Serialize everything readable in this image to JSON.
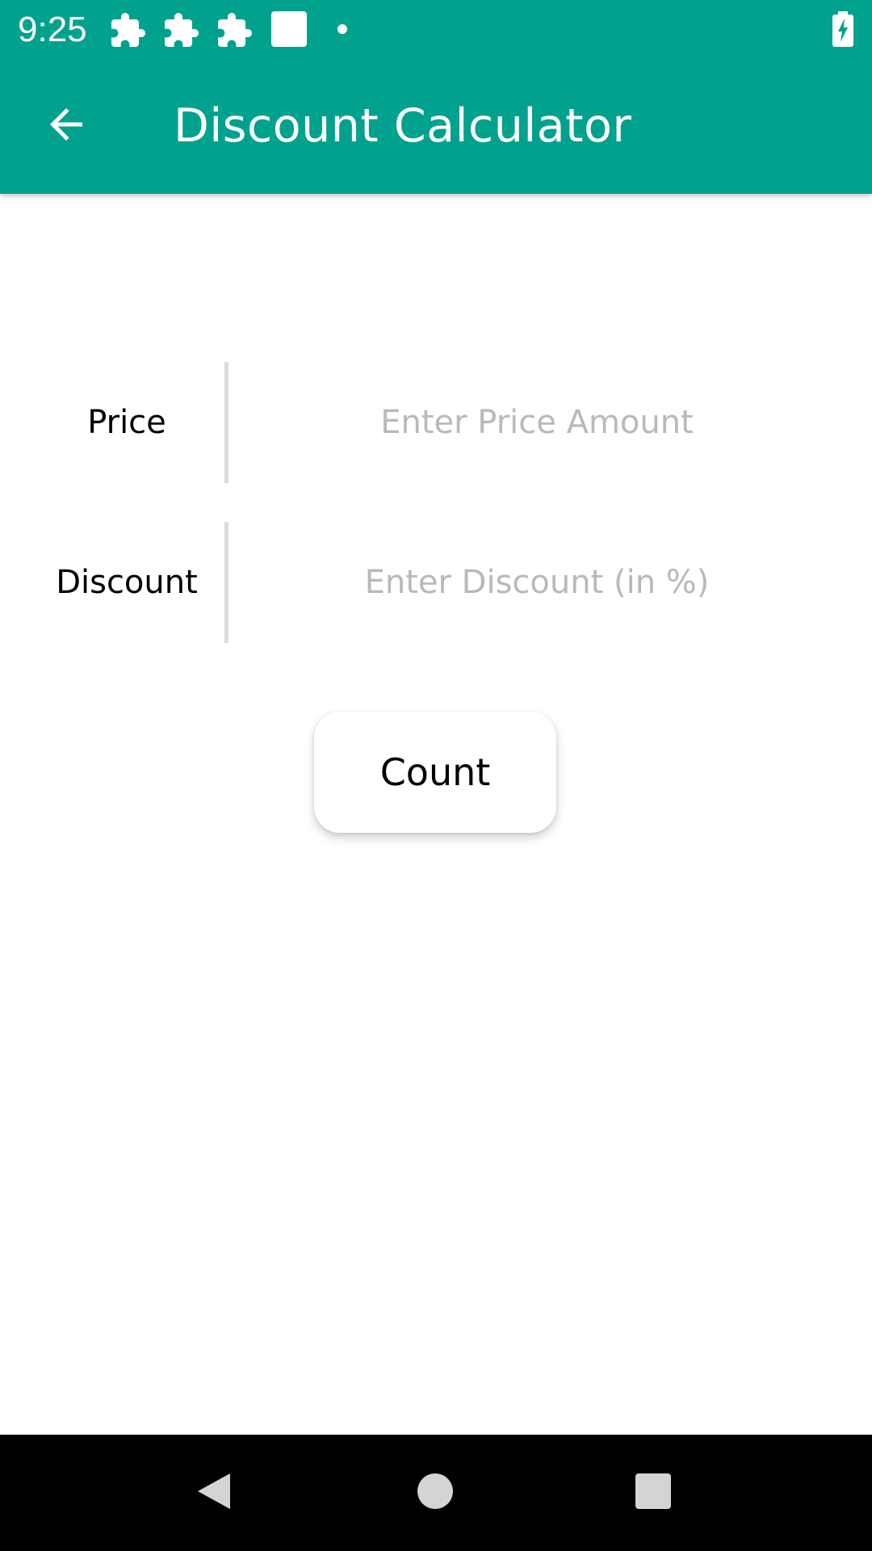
{
  "status_bar": {
    "time": "9:25",
    "icons": [
      "puzzle-icon",
      "puzzle-icon",
      "puzzle-icon",
      "square-notification-icon",
      "dot-icon",
      "battery-charging-icon"
    ],
    "background": "#00a28d"
  },
  "app_bar": {
    "title": "Discount Calculator",
    "back_icon": "arrow-left-icon",
    "background": "#00a28d"
  },
  "form": {
    "price": {
      "label": "Price",
      "value": "",
      "placeholder": "Enter Price Amount"
    },
    "discount": {
      "label": "Discount",
      "value": "",
      "placeholder": "Enter Discount (in %)"
    }
  },
  "actions": {
    "count_label": "Count"
  },
  "nav_bar": {
    "icons": [
      "back-triangle-icon",
      "home-circle-icon",
      "recents-square-icon"
    ]
  },
  "colors": {
    "accent": "#00a28d",
    "placeholder": "#b9b9b9",
    "divider": "#dcdcdc"
  }
}
